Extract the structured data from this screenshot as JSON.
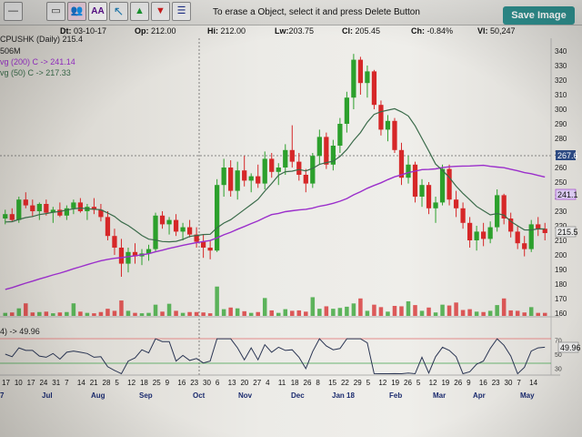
{
  "toolbar": {
    "tools": [
      {
        "name": "minus-tool",
        "glyph": "—"
      },
      {
        "name": "rectangle-tool",
        "glyph": "▭"
      },
      {
        "name": "people-tool",
        "glyph": "👥"
      },
      {
        "name": "text-aa-tool",
        "glyph": "AA"
      },
      {
        "name": "arrow-ne-tool",
        "glyph": "↖"
      },
      {
        "name": "arrow-up-tool",
        "glyph": "▲"
      },
      {
        "name": "arrow-down-tool",
        "glyph": "▼"
      },
      {
        "name": "lines-tool",
        "glyph": "☰"
      }
    ],
    "hint": "To erase a Object, select it and press Delete Button",
    "save_label": "Save Image"
  },
  "info": {
    "dt_label": "Dt:",
    "dt": "03-10-17",
    "op_label": "Op:",
    "op": "212.00",
    "hi_label": "Hi:",
    "hi": "212.00",
    "lw_label": "Lw:",
    "lw": "203.75",
    "cl_label": "Cl:",
    "cl": "205.45",
    "ch_label": "Ch:",
    "ch": "-0.84%",
    "vl_label": "Vl:",
    "vl": "50,247"
  },
  "legend": {
    "symbol": "CPUSHK (Daily) 215.4",
    "volume": "506M",
    "ma200": "vg (200) C -> 241.14",
    "ma50": "vg (50) C -> 217.33",
    "rsi": "4) -> 49.96"
  },
  "colors": {
    "up": "#2ca02c",
    "down": "#d62728",
    "ma200": "#9b2fcb",
    "ma50": "#3a6b4a",
    "rsi": "#2a3553",
    "rsi_upper": "#e06b6b",
    "rsi_lower": "#3fa04a",
    "save_button": "#2e8f8e"
  },
  "chart_data": {
    "type": "candlestick",
    "y_ticks": [
      160,
      170,
      180,
      190,
      200,
      210,
      220,
      230,
      240,
      250,
      260,
      270,
      280,
      290,
      300,
      310,
      320,
      330,
      340
    ],
    "price_labels": {
      "last": "215.5",
      "ma200": "241.1",
      "crosshair": "267.6"
    },
    "rsi_ticks": [
      "70",
      "50",
      "30"
    ],
    "rsi_value_label": "49.96",
    "day_labels": [
      "17",
      "10",
      "17",
      "24",
      "31",
      "7",
      "14",
      "21",
      "28",
      "5",
      "12",
      "18",
      "25",
      "9",
      "16",
      "23",
      "30",
      "6",
      "13",
      "20",
      "27",
      "4",
      "11",
      "18",
      "26",
      "8",
      "15",
      "22",
      "29",
      "5",
      "12",
      "19",
      "26",
      "5",
      "12",
      "19",
      "26",
      "9",
      "16",
      "23",
      "30",
      "7",
      "14"
    ],
    "month_labels": [
      "7",
      "Jul",
      "Aug",
      "Sep",
      "Oct",
      "Nov",
      "Dec",
      "Jan 18",
      "Feb",
      "Mar",
      "Apr",
      "May"
    ],
    "candles": [
      [
        225,
        231,
        221,
        228
      ],
      [
        228,
        232,
        223,
        224
      ],
      [
        224,
        240,
        222,
        238
      ],
      [
        238,
        243,
        232,
        234
      ],
      [
        234,
        238,
        226,
        230
      ],
      [
        230,
        236,
        224,
        235
      ],
      [
        235,
        238,
        227,
        229
      ],
      [
        229,
        233,
        222,
        231
      ],
      [
        231,
        236,
        226,
        227
      ],
      [
        227,
        234,
        224,
        232
      ],
      [
        232,
        238,
        228,
        236
      ],
      [
        236,
        239,
        229,
        230
      ],
      [
        230,
        235,
        224,
        233
      ],
      [
        233,
        239,
        228,
        231
      ],
      [
        231,
        235,
        223,
        226
      ],
      [
        226,
        230,
        210,
        213
      ],
      [
        213,
        218,
        200,
        205
      ],
      [
        205,
        211,
        185,
        194
      ],
      [
        194,
        205,
        188,
        202
      ],
      [
        202,
        208,
        194,
        199
      ],
      [
        199,
        204,
        193,
        201
      ],
      [
        201,
        207,
        196,
        204
      ],
      [
        204,
        229,
        202,
        227
      ],
      [
        227,
        230,
        218,
        221
      ],
      [
        221,
        226,
        214,
        224
      ],
      [
        224,
        228,
        213,
        216
      ],
      [
        216,
        222,
        210,
        219
      ],
      [
        219,
        224,
        212,
        214
      ],
      [
        214,
        219,
        205,
        209
      ],
      [
        209,
        214,
        198,
        205
      ],
      [
        205,
        210,
        197,
        203
      ],
      [
        203,
        252,
        202,
        248
      ],
      [
        248,
        266,
        240,
        260
      ],
      [
        260,
        265,
        240,
        244
      ],
      [
        244,
        264,
        238,
        258
      ],
      [
        258,
        268,
        247,
        251
      ],
      [
        251,
        256,
        243,
        254
      ],
      [
        254,
        262,
        246,
        249
      ],
      [
        249,
        271,
        245,
        266
      ],
      [
        266,
        270,
        253,
        257
      ],
      [
        257,
        263,
        248,
        260
      ],
      [
        260,
        276,
        255,
        272
      ],
      [
        272,
        289,
        260,
        264
      ],
      [
        264,
        270,
        251,
        255
      ],
      [
        255,
        259,
        243,
        249
      ],
      [
        249,
        270,
        246,
        268
      ],
      [
        268,
        286,
        262,
        281
      ],
      [
        281,
        284,
        259,
        262
      ],
      [
        262,
        279,
        258,
        275
      ],
      [
        275,
        294,
        270,
        290
      ],
      [
        290,
        312,
        284,
        308
      ],
      [
        308,
        338,
        300,
        334
      ],
      [
        334,
        336,
        310,
        318
      ],
      [
        318,
        330,
        308,
        326
      ],
      [
        326,
        327,
        300,
        303
      ],
      [
        303,
        306,
        282,
        286
      ],
      [
        286,
        296,
        278,
        292
      ],
      [
        292,
        294,
        270,
        272
      ],
      [
        272,
        277,
        248,
        253
      ],
      [
        253,
        268,
        249,
        262
      ],
      [
        262,
        264,
        236,
        240
      ],
      [
        240,
        252,
        233,
        248
      ],
      [
        248,
        250,
        228,
        232
      ],
      [
        232,
        240,
        222,
        236
      ],
      [
        236,
        262,
        234,
        259
      ],
      [
        259,
        262,
        234,
        238
      ],
      [
        238,
        244,
        226,
        232
      ],
      [
        232,
        236,
        218,
        222
      ],
      [
        222,
        226,
        205,
        210
      ],
      [
        210,
        220,
        203,
        216
      ],
      [
        216,
        222,
        206,
        211
      ],
      [
        211,
        223,
        208,
        219
      ],
      [
        219,
        245,
        216,
        241
      ],
      [
        241,
        242,
        221,
        225
      ],
      [
        225,
        229,
        212,
        216
      ],
      [
        216,
        220,
        204,
        208
      ],
      [
        208,
        213,
        199,
        204
      ],
      [
        204,
        224,
        202,
        221
      ],
      [
        221,
        226,
        213,
        218
      ],
      [
        218,
        222,
        210,
        215
      ]
    ]
  }
}
